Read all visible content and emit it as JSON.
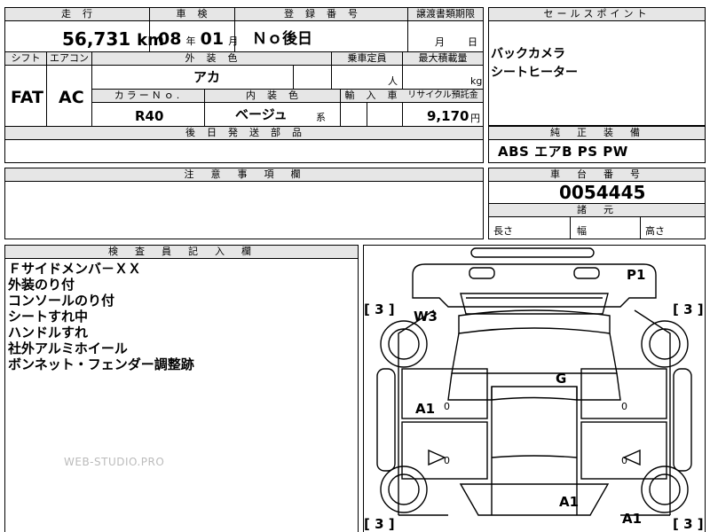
{
  "top_section": {
    "mileage": {
      "header": "走　行",
      "value": "56,731",
      "unit": "km"
    },
    "inspection": {
      "header": "車　検",
      "year": "08",
      "year_unit": "年",
      "month": "01",
      "month_unit": "月"
    },
    "registration": {
      "header": "登　録　番　号",
      "value": "Ｎｏ後日"
    },
    "transfer_deadline": {
      "header": "譲渡書類期限",
      "month_unit": "月",
      "day_unit": "日"
    },
    "shift": {
      "header": "シフト",
      "value": "FAT"
    },
    "aircon": {
      "header": "エアコン",
      "value": "AC"
    },
    "exterior_color": {
      "header": "外　装　色",
      "value": "アカ"
    },
    "capacity": {
      "header": "乗車定員",
      "unit": "人"
    },
    "max_load": {
      "header": "最大積載量",
      "unit": "kg"
    },
    "color_no": {
      "header": "カラーＮｏ.",
      "value": "R40"
    },
    "interior_color": {
      "header": "内　装　色",
      "value": "ベージュ",
      "suffix": "系"
    },
    "import": {
      "header": "輸　入　車"
    },
    "recycle": {
      "header": "リサイクル預託金",
      "value": "9,170",
      "unit": "円"
    },
    "later_parts": {
      "header": "後　日　発　送　部　品"
    }
  },
  "sales_point": {
    "header": "セールスポイント",
    "lines": [
      "バックカメラ",
      "シートヒーター"
    ]
  },
  "standard_equipment": {
    "header": "純　正　装　備",
    "value": "ABS エアB PS PW"
  },
  "caution": {
    "header": "注　意　事　項　欄"
  },
  "chassis": {
    "header": "車　台　番　号",
    "value": "0054445"
  },
  "specs": {
    "header": "諸　元",
    "length": "長さ",
    "width": "幅",
    "height": "高さ"
  },
  "inspector_notes": {
    "header": "検　査　員　記　入　欄",
    "lines": [
      "Ｆサイドメンバ－ＸＸ",
      "外装のり付",
      "コンソールのり付",
      "シートすれ中",
      "ハンドルすれ",
      "社外アルミホイール",
      "ボンネット・フェンダー調整跡"
    ]
  },
  "watermark": "WEB-STUDIO.PRO",
  "diagram": {
    "marks": {
      "p1": "P1",
      "w3": "W3",
      "g": "G",
      "a1_left": "A1",
      "a1_bottom": "A1",
      "a1_bottom_right": "A1"
    },
    "tire_left_top": "3",
    "tire_right_top": "3",
    "tire_left_bottom": "3",
    "tire_right_bottom": "3",
    "door_digit": "0",
    "bracket_open": "[",
    "bracket_close": "]"
  }
}
